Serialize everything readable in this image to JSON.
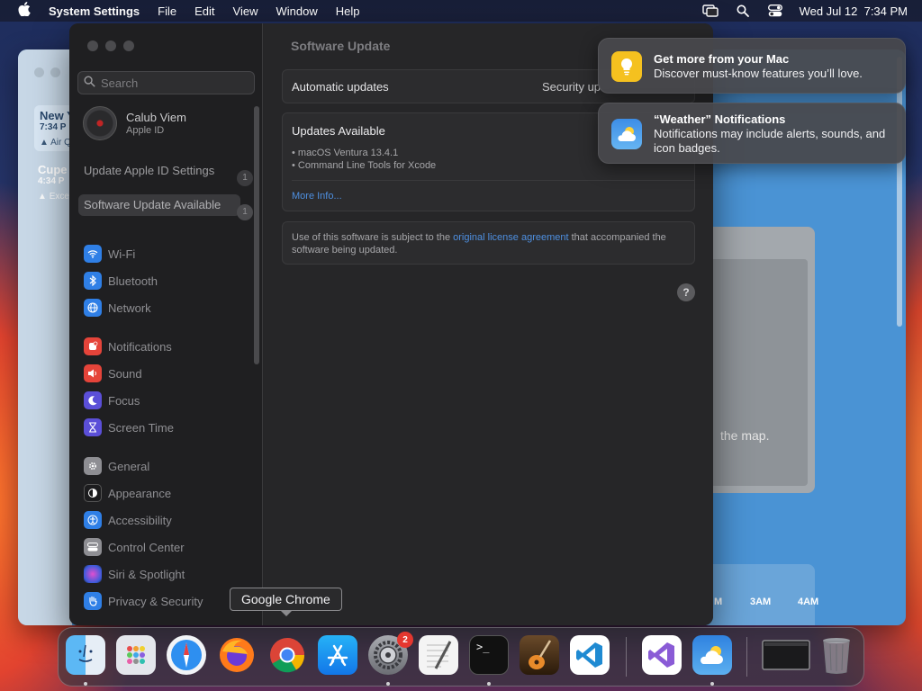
{
  "menubar": {
    "app_name": "System Settings",
    "menus": [
      "File",
      "Edit",
      "View",
      "Window",
      "Help"
    ],
    "datetime": "Wed Jul 12  7:34 PM"
  },
  "weather_bg": {
    "locations": [
      {
        "name": "New Y",
        "time": "7:34 P",
        "alert": "Air Q"
      },
      {
        "name": "Cupe",
        "time": "4:34 P",
        "alert": "Exce"
      }
    ],
    "map_hint": "the map.",
    "hours": [
      "3AM",
      "4AM"
    ],
    "hour_partial": "M"
  },
  "settings": {
    "search_placeholder": "Search",
    "account": {
      "name": "Calub Viem",
      "subtitle": "Apple ID"
    },
    "pending": [
      {
        "label": "Update Apple ID Settings",
        "count": "1"
      },
      {
        "label": "Software Update Available",
        "count": "1"
      }
    ],
    "groups": [
      [
        {
          "label": "Wi-Fi",
          "icon": "wifi-icon",
          "color": "#2f7fe6"
        },
        {
          "label": "Bluetooth",
          "icon": "bluetooth-icon",
          "color": "#2f7fe6"
        },
        {
          "label": "Network",
          "icon": "globe-icon",
          "color": "#2f7fe6"
        }
      ],
      [
        {
          "label": "Notifications",
          "icon": "bell-icon",
          "color": "#e5443a"
        },
        {
          "label": "Sound",
          "icon": "speaker-icon",
          "color": "#e5443a"
        },
        {
          "label": "Focus",
          "icon": "moon-icon",
          "color": "#5b4fd8"
        },
        {
          "label": "Screen Time",
          "icon": "hourglass-icon",
          "color": "#5b4fd8"
        }
      ],
      [
        {
          "label": "General",
          "icon": "gear-icon",
          "color": "#8e8e93"
        },
        {
          "label": "Appearance",
          "icon": "appearance-icon",
          "color": "#1c1c1e"
        },
        {
          "label": "Accessibility",
          "icon": "accessibility-icon",
          "color": "#2f7fe6"
        },
        {
          "label": "Control Center",
          "icon": "control-center-icon",
          "color": "#8e8e93"
        },
        {
          "label": "Siri & Spotlight",
          "icon": "siri-icon",
          "color": "#7a3fd0"
        },
        {
          "label": "Privacy & Security",
          "icon": "hand-icon",
          "color": "#2f7fe6"
        }
      ]
    ],
    "main": {
      "title": "Software Update",
      "auto_label": "Automatic updates",
      "auto_value": "Security up",
      "updates_title": "Updates Available",
      "updates": [
        "• macOS Ventura 13.4.1",
        "• Command Line Tools for Xcode"
      ],
      "more_info": "More Info...",
      "license_pre": "Use of this software is subject to the ",
      "license_link": "original license agreement",
      "license_post": " that accompanied the software being updated.",
      "help": "?"
    }
  },
  "notifications": [
    {
      "title": "Get more from your Mac",
      "body": "Discover must-know features you’ll love.",
      "icon": "tips-icon"
    },
    {
      "title": "“Weather” Notifications",
      "body": "Notifications may include alerts, sounds, and icon badges.",
      "icon": "weather-icon"
    }
  ],
  "tooltip": "Google Chrome",
  "dock": {
    "apps": [
      "Finder",
      "Launchpad",
      "Safari",
      "Firefox",
      "Google Chrome",
      "App Store",
      "System Settings",
      "TextEdit",
      "Terminal",
      "GarageBand",
      "Visual Studio Code",
      "Visual Studio",
      "Weather",
      "Window",
      "Trash"
    ],
    "system_settings_badge": "2"
  },
  "colors": {
    "accent": "#4e8fe0",
    "badge_red": "#e5372f"
  }
}
